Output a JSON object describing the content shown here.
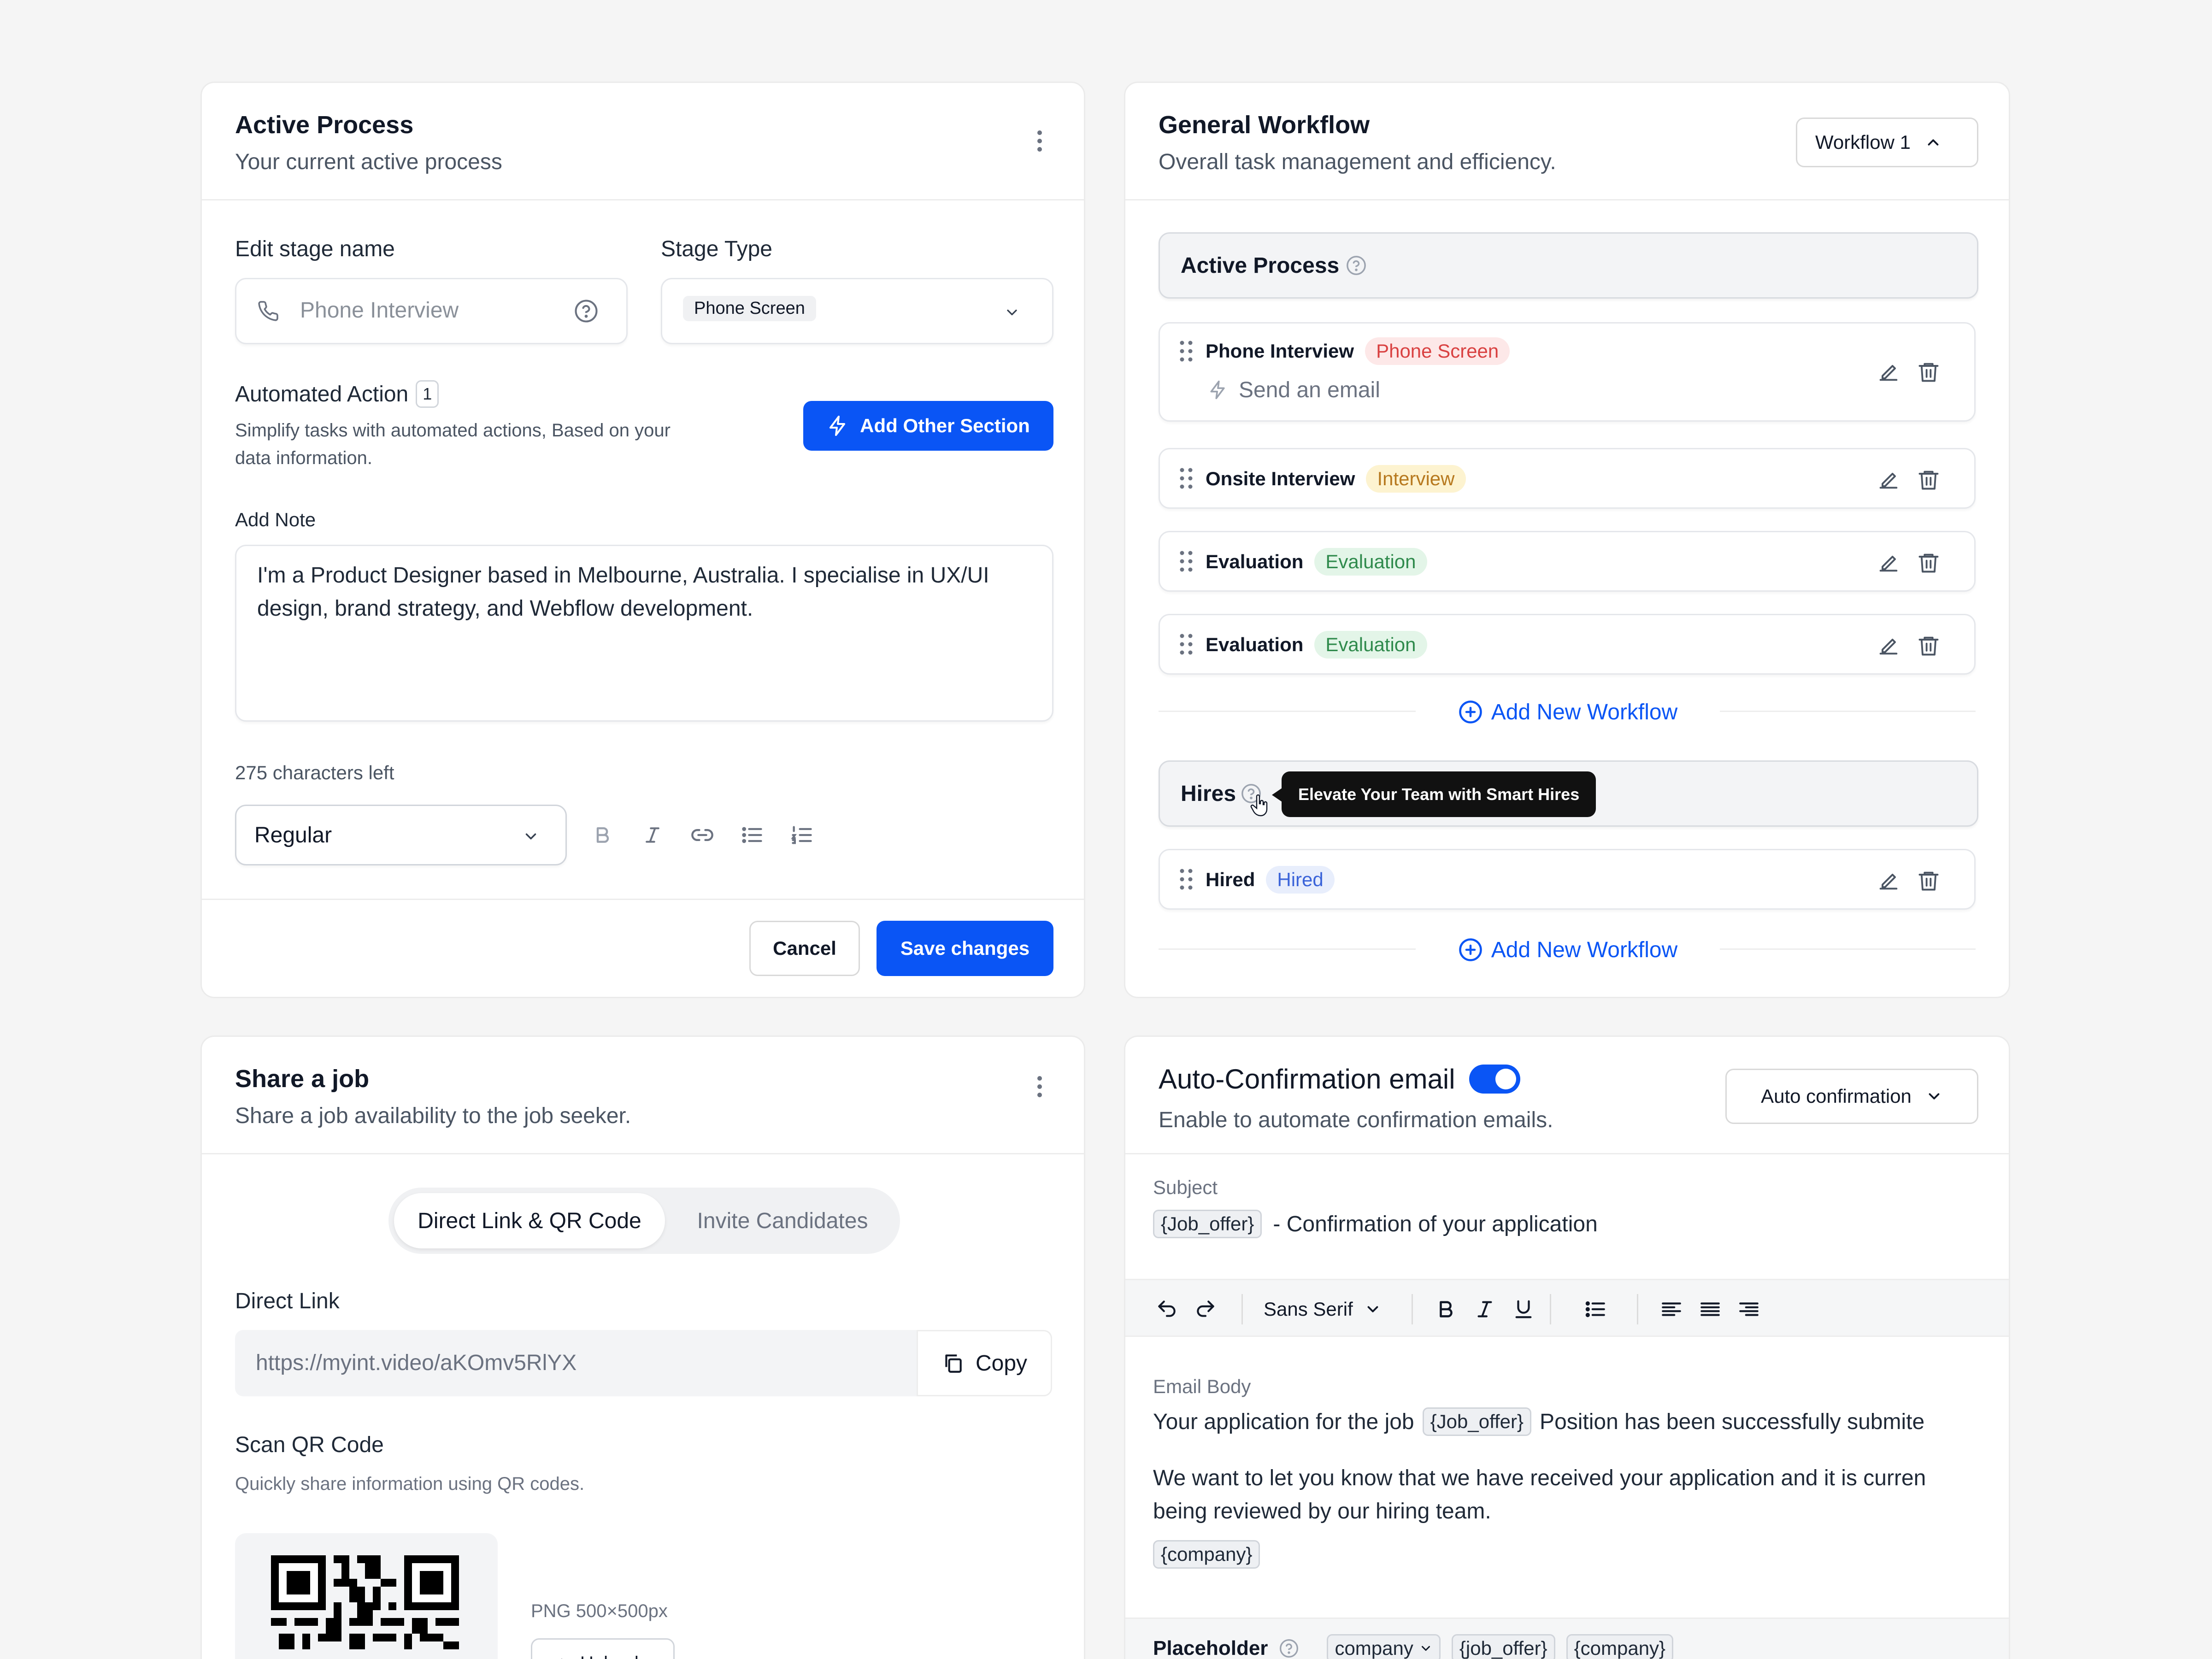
{
  "active_process_card": {
    "title": "Active Process",
    "subtitle": "Your current active process",
    "edit_stage_label": "Edit stage name",
    "stage_name_placeholder": "Phone Interview",
    "stage_type_label": "Stage Type",
    "stage_type_value": "Phone Screen",
    "automated_action_label": "Automated Action",
    "automated_action_count": "1",
    "automated_action_desc_1": "Simplify tasks with automated actions, Based on your",
    "automated_action_desc_2": "data information.",
    "add_section_label": "Add Other Section",
    "add_note_label": "Add Note",
    "note_line_1": "I'm a Product Designer based in Melbourne, Australia. I specialise in UX/UI",
    "note_line_2": "design, brand strategy, and Webflow development.",
    "chars_left": "275 characters left",
    "font_style": "Regular",
    "cancel_label": "Cancel",
    "save_label": "Save changes"
  },
  "workflow_card": {
    "title": "General Workflow",
    "subtitle": "Overall task management and efficiency.",
    "workflow_select": "Workflow 1",
    "active_group_title": "Active Process",
    "stages": [
      {
        "name": "Phone Interview",
        "tag": "Phone Screen",
        "action": "Send an email"
      },
      {
        "name": "Onsite Interview",
        "tag": "Interview"
      },
      {
        "name": "Evaluation",
        "tag": "Evaluation"
      },
      {
        "name": "Evaluation",
        "tag": "Evaluation"
      }
    ],
    "add_workflow_label": "Add New Workflow",
    "hires_group_title": "Hires",
    "tooltip": "Elevate Your Team with Smart Hires",
    "hired_stage": {
      "name": "Hired",
      "tag": "Hired"
    },
    "add_workflow_label_2": "Add New Workflow"
  },
  "share_card": {
    "title": "Share a job",
    "subtitle": "Share a job availability to the job seeker.",
    "tab_active": "Direct Link & QR Code",
    "tab_inactive": "Invite Candidates",
    "direct_link_label": "Direct Link",
    "link_value": "https://myint.video/aKOmv5RlYX",
    "copy_label": "Copy",
    "qr_label": "Scan QR Code",
    "qr_desc": "Quickly share information using QR codes.",
    "qr_format": "PNG 500×500px",
    "upload_label": "Upload"
  },
  "email_card": {
    "title": "Auto-Confirmation email",
    "subtitle": "Enable to automate confirmation emails.",
    "mode_select": "Auto confirmation",
    "subject_label": "Subject",
    "subject_tag": "{Job_offer}",
    "subject_text": "- Confirmation of your application",
    "font_family_select": "Sans Serif",
    "body_label": "Email Body",
    "body_line1_pre": "Your application for the job",
    "body_line1_tag": "{Job_offer}",
    "body_line1_post": "Position has been successfully submite",
    "body_line2": "We want to let you know that we have received your application and it is curren",
    "body_line3": "being reviewed by our hiring team.",
    "company_tag": "{company}",
    "placeholder_label": "Placeholder",
    "placeholder_tags": [
      "company",
      "{job_offer}",
      "{company}"
    ]
  },
  "colors": {
    "primary": "#0a55f5",
    "phone_screen_tag": "#fde8e8",
    "interview_tag": "#fdf3d0",
    "evaluation_tag": "#e3f5e8",
    "hired_tag": "#e8eefc"
  }
}
